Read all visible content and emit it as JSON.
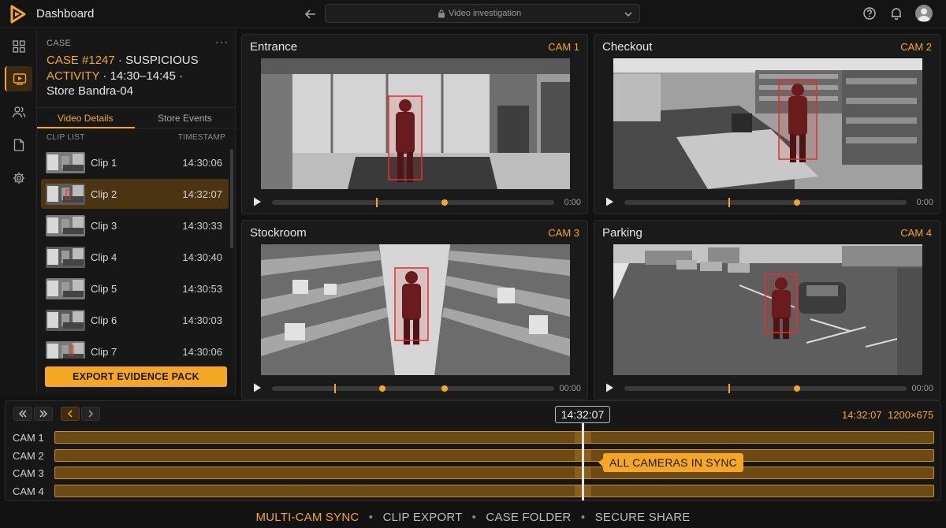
{
  "header": {
    "app_title": "Dashboard",
    "address": "Video investigation",
    "icons": [
      "back-arrow-icon",
      "lock-icon",
      "chevron-down-icon",
      "help-icon",
      "bell-icon",
      "user-avatar-icon"
    ]
  },
  "rail": {
    "items": [
      {
        "name": "grid-icon",
        "active": false
      },
      {
        "name": "video-icon",
        "active": true
      },
      {
        "name": "users-icon",
        "active": false
      },
      {
        "name": "document-icon",
        "active": false
      },
      {
        "name": "gear-icon",
        "active": false
      }
    ]
  },
  "case": {
    "label": "CASE",
    "more": "···",
    "id": "CASE #1247",
    "dot1": " · ",
    "title_part1": "SUSPICIOUS",
    "title_part2": "ACTIVITY",
    "time_range": " · 14:30–14:45 ·",
    "store": "Store Bandra-04",
    "tabs": [
      "Video Details",
      "Store Events"
    ],
    "list_header": {
      "left": "CLIP LIST",
      "right": "TIMESTAMP"
    },
    "clips": [
      {
        "name": "Clip 1",
        "timestamp": "14:30:06",
        "active": false
      },
      {
        "name": "Clip 2",
        "timestamp": "14:32:07",
        "active": true
      },
      {
        "name": "Clip 3",
        "timestamp": "14:30:33",
        "active": false
      },
      {
        "name": "Clip 4",
        "timestamp": "14:30:40",
        "active": false
      },
      {
        "name": "Clip 5",
        "timestamp": "14:30:53",
        "active": false
      },
      {
        "name": "Clip 6",
        "timestamp": "14:30:03",
        "active": false
      },
      {
        "name": "Clip 7",
        "timestamp": "14:30:06",
        "active": false
      }
    ],
    "export_label": "EXPORT EVIDENCE PACK"
  },
  "cameras": [
    {
      "title": "Entrance",
      "cam": "CAM 1",
      "time": "0:00",
      "progress": 0.6
    },
    {
      "title": "Checkout",
      "cam": "CAM 2",
      "time": "0:00",
      "progress": 0.6
    },
    {
      "title": "Stockroom",
      "cam": "CAM 3",
      "time": "00:00",
      "progress": 0.6
    },
    {
      "title": "Parking",
      "cam": "CAM 4",
      "time": "00:00",
      "progress": 0.6
    }
  ],
  "timeline": {
    "playhead": "14:32:07",
    "right_time": "14:32:07",
    "right_dims": "1200×675",
    "tracks": [
      "CAM 1",
      "CAM 2",
      "CAM 3",
      "CAM 4"
    ],
    "sync_label": "ALL CAMERAS IN SYNC",
    "playhead_fraction": 0.6
  },
  "footer": {
    "items": [
      "MULTI-CAM SYNC",
      "CLIP EXPORT",
      "CASE FOLDER",
      "SECURE SHARE"
    ],
    "separator": "•"
  },
  "colors": {
    "accent": "#f5a623",
    "detection": "#e0312f",
    "background": "#121212"
  }
}
